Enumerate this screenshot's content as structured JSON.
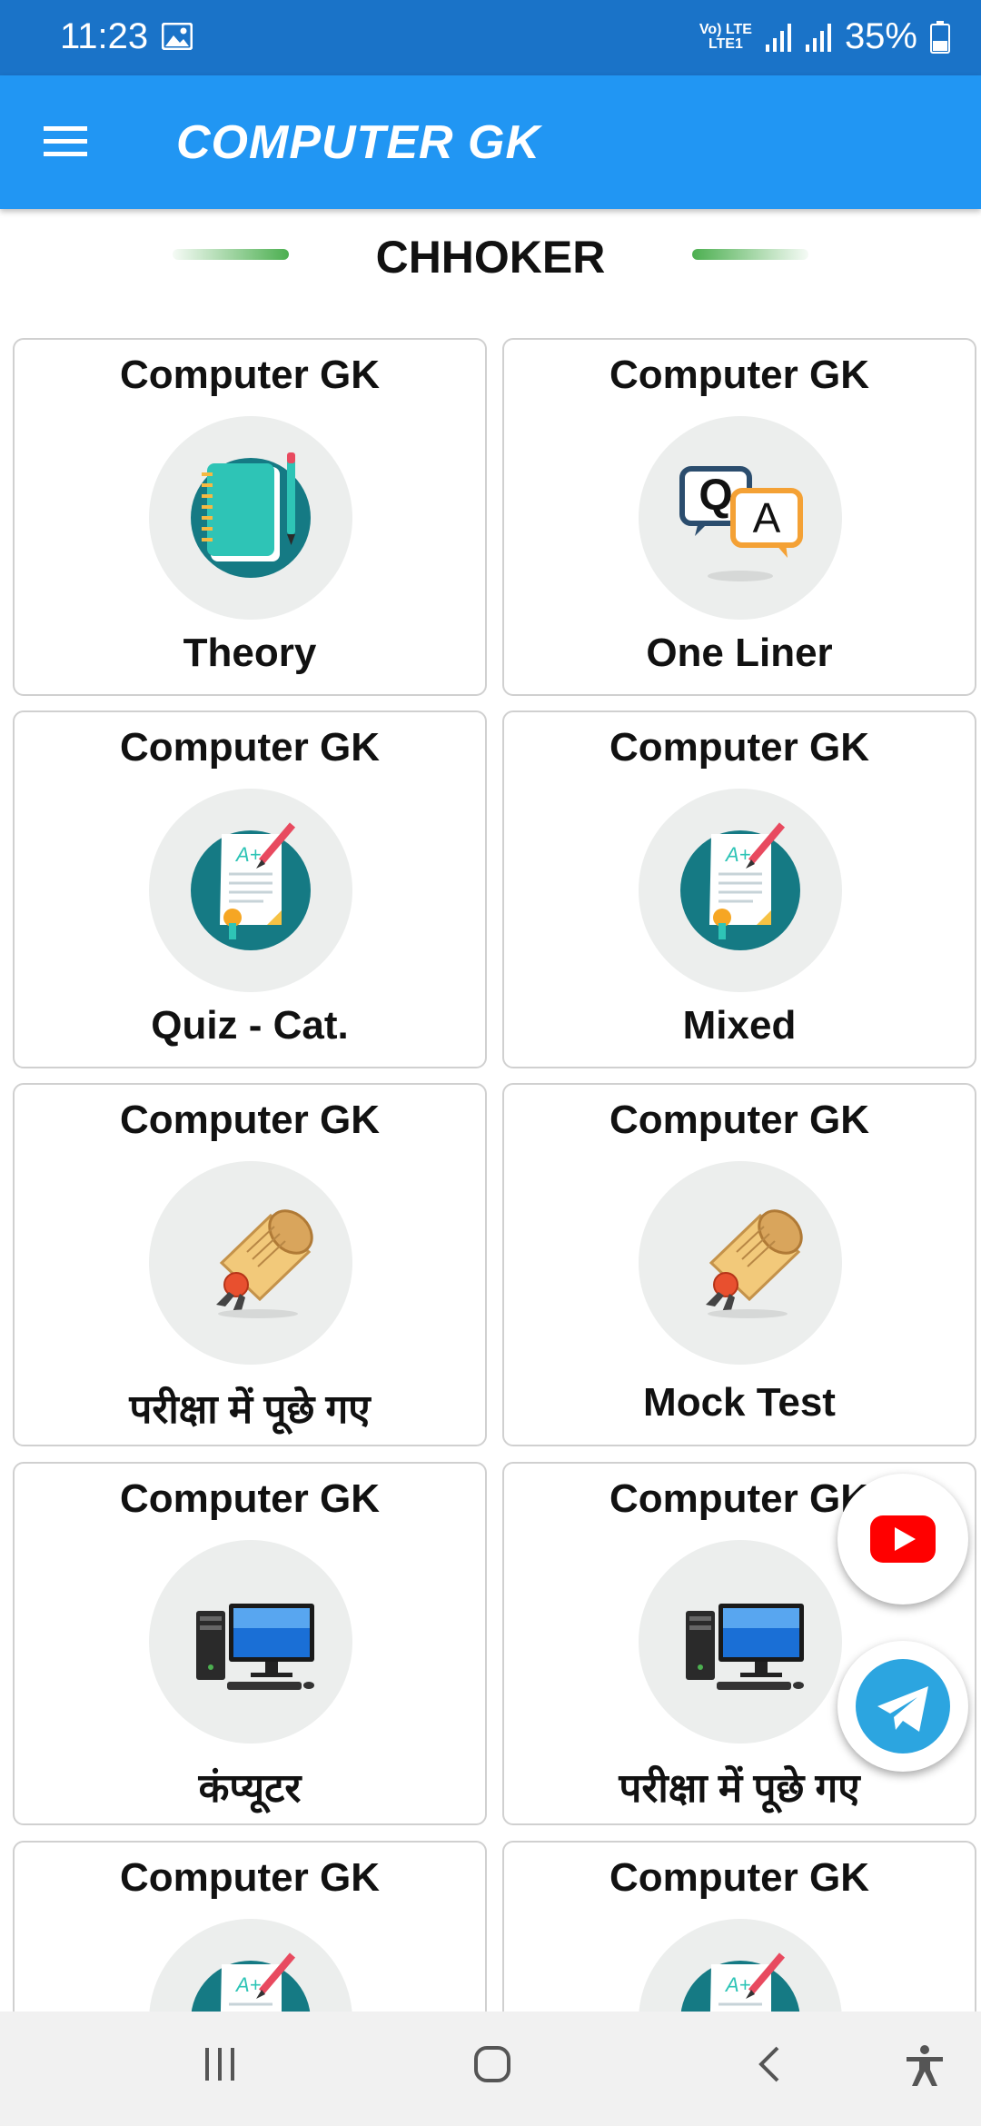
{
  "status_bar": {
    "time": "11:23",
    "network_line1": "Vo) LTE",
    "network_line2": "LTE1",
    "battery": "35%",
    "icons": [
      "gallery-icon",
      "signal-icon",
      "signal-icon",
      "battery-icon"
    ]
  },
  "app_bar": {
    "title": "COMPUTER GK",
    "menu_icon": "hamburger-menu-icon"
  },
  "header": {
    "title": "CHHOKER"
  },
  "cards": [
    {
      "title": "Computer GK",
      "label": "Theory",
      "icon": "notebook-icon"
    },
    {
      "title": "Computer GK",
      "label": "One Liner",
      "icon": "qa-chat-icon"
    },
    {
      "title": "Computer GK",
      "label": "Quiz - Cat.",
      "icon": "exam-paper-icon"
    },
    {
      "title": "Computer GK",
      "label": "Mixed",
      "icon": "exam-paper-icon"
    },
    {
      "title": "Computer GK",
      "label": "परीक्षा में पूछे गए",
      "icon": "certificate-scroll-icon"
    },
    {
      "title": "Computer GK",
      "label": "Mock Test",
      "icon": "certificate-scroll-icon"
    },
    {
      "title": "Computer GK",
      "label": "कंप्यूटर",
      "icon": "desktop-computer-icon"
    },
    {
      "title": "Computer GK",
      "label": "परीक्षा में पूछे गए",
      "icon": "desktop-computer-icon"
    },
    {
      "title": "Computer GK",
      "label": "",
      "icon": "exam-paper-icon"
    },
    {
      "title": "Computer GK",
      "label": "",
      "icon": "exam-paper-icon"
    }
  ],
  "floating_buttons": [
    {
      "icon": "youtube-icon",
      "color": "#ff0000"
    },
    {
      "icon": "telegram-icon",
      "color": "#2ca5e0"
    }
  ],
  "nav_bar": {
    "icons": [
      "recent-apps-icon",
      "home-icon",
      "back-icon",
      "accessibility-icon"
    ]
  },
  "colors": {
    "status_bar": "#1a73c8",
    "app_bar": "#2196f3",
    "accent_green": "#4caf50"
  }
}
